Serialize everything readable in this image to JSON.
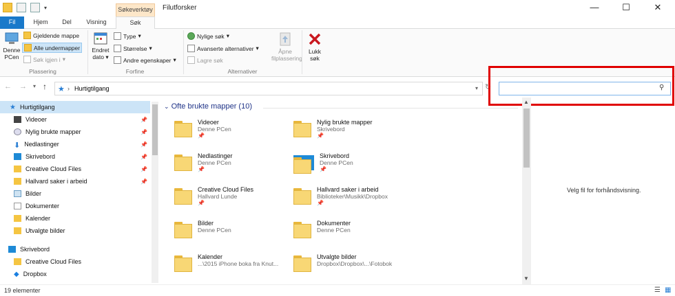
{
  "title_bar": {
    "context_tab": "Søkeverktøy",
    "window_title": "Filutforsker",
    "minimize": "—",
    "maximize": "☐",
    "close": "✕"
  },
  "tabs": [
    "Fil",
    "Hjem",
    "Del",
    "Visning",
    "Søk"
  ],
  "ribbon": {
    "pc_label_1": "Denne",
    "pc_label_2": "PCen",
    "current_folder": "Gjeldende mappe",
    "all_subfolders": "Alle undermapper",
    "search_again": "Søk igjen i",
    "group_location": "Plassering",
    "changed_1": "Endret",
    "changed_2": "dato",
    "type": "Type",
    "size": "Størrelse",
    "other_props": "Andre egenskaper",
    "group_refine": "Forfine",
    "recent_searches": "Nylige søk",
    "advanced": "Avanserte alternativer",
    "save_search": "Lagre søk",
    "group_options": "Alternativer",
    "open_loc_1": "Åpne",
    "open_loc_2": "filplassering",
    "close_1": "Lukk",
    "close_2": "søk"
  },
  "address": {
    "path": "Hurtigtilgang"
  },
  "search": {
    "placeholder": ""
  },
  "nav": {
    "items": [
      {
        "label": "Hurtigtilgang",
        "pinned": false
      },
      {
        "label": "Videoer",
        "pinned": true
      },
      {
        "label": "Nylig brukte mapper",
        "pinned": true
      },
      {
        "label": "Nedlastinger",
        "pinned": true
      },
      {
        "label": "Skrivebord",
        "pinned": true
      },
      {
        "label": "Creative Cloud Files",
        "pinned": true
      },
      {
        "label": "Hallvard saker i arbeid",
        "pinned": true
      },
      {
        "label": "Bilder",
        "pinned": false
      },
      {
        "label": "Dokumenter",
        "pinned": false
      },
      {
        "label": "Kalender",
        "pinned": false
      },
      {
        "label": "Utvalgte bilder",
        "pinned": false
      },
      {
        "label": "Skrivebord",
        "pinned": false
      },
      {
        "label": "Creative Cloud Files",
        "pinned": false
      },
      {
        "label": "Dropbox",
        "pinned": false
      }
    ]
  },
  "content": {
    "group_header": "Ofte brukte mapper (10)",
    "tiles": [
      {
        "name": "Videoer",
        "loc": "Denne PCen",
        "pinned": true
      },
      {
        "name": "Nylig brukte mapper",
        "loc": "Skrivebord",
        "pinned": true
      },
      {
        "name": "Nedlastinger",
        "loc": "Denne PCen",
        "pinned": true
      },
      {
        "name": "Skrivebord",
        "loc": "Denne PCen",
        "pinned": true
      },
      {
        "name": "Creative Cloud Files",
        "loc": "Hallvard Lunde",
        "pinned": true
      },
      {
        "name": "Hallvard saker i arbeid",
        "loc": "Biblioteker\\Musikk\\Dropbox",
        "pinned": true
      },
      {
        "name": "Bilder",
        "loc": "Denne PCen",
        "pinned": false
      },
      {
        "name": "Dokumenter",
        "loc": "Denne PCen",
        "pinned": false
      },
      {
        "name": "Kalender",
        "loc": "...\\2015 iPhone boka fra Knut...",
        "pinned": false
      },
      {
        "name": "Utvalgte bilder",
        "loc": "Dropbox\\Dropbox\\...\\Fotobok",
        "pinned": false
      }
    ]
  },
  "preview": {
    "text": "Velg fil for forhåndsvisning."
  },
  "status": {
    "count": "19 elementer"
  },
  "colors": {
    "accent": "#1979ca",
    "highlight": "#e00000",
    "selection": "#cce4f7"
  }
}
